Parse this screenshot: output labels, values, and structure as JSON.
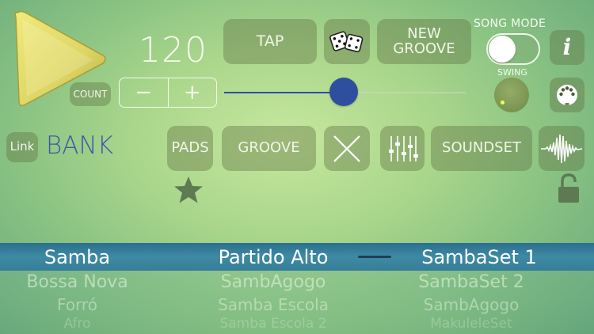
{
  "transport": {
    "tempo": "120",
    "count_label": "COUNT",
    "minus_label": "−",
    "plus_label": "+",
    "tempo_slider_level": 0.5
  },
  "toolbar": {
    "tap_label": "TAP",
    "new_groove_label_line1": "NEW",
    "new_groove_label_line2": "GROOVE",
    "song_mode_label": "SONG MODE",
    "song_mode_on": false,
    "swing_label": "SWING",
    "info_label": "i"
  },
  "bank_row": {
    "link_label": "Link",
    "bank_label": "BANK",
    "pads_label": "PADS",
    "groove_label": "GROOVE",
    "soundset_label": "SOUNDSET"
  },
  "picker": {
    "columns": [
      {
        "items": [
          "Samba",
          "Bossa Nova",
          "Forró",
          "Afro"
        ]
      },
      {
        "items": [
          "Partido Alto",
          "SambAgogo",
          "Samba Escola",
          "Samba Escola 2"
        ]
      },
      {
        "items": [
          "SambaSet 1",
          "SambaSet 2",
          "SambAgogo",
          "MakuleleSet"
        ]
      }
    ]
  },
  "icons": {
    "play": "play-icon",
    "dice": "dice-icon",
    "midi": "midi-connector-icon",
    "close": "x-icon",
    "mixer": "mixer-sliders-icon",
    "waveform": "waveform-icon",
    "star": "star-icon",
    "lock": "lock-icon"
  },
  "colors": {
    "accent_blue": "#2e4f9d",
    "play_yellow": "#e3dc6a",
    "selection_band": "#357e99"
  }
}
